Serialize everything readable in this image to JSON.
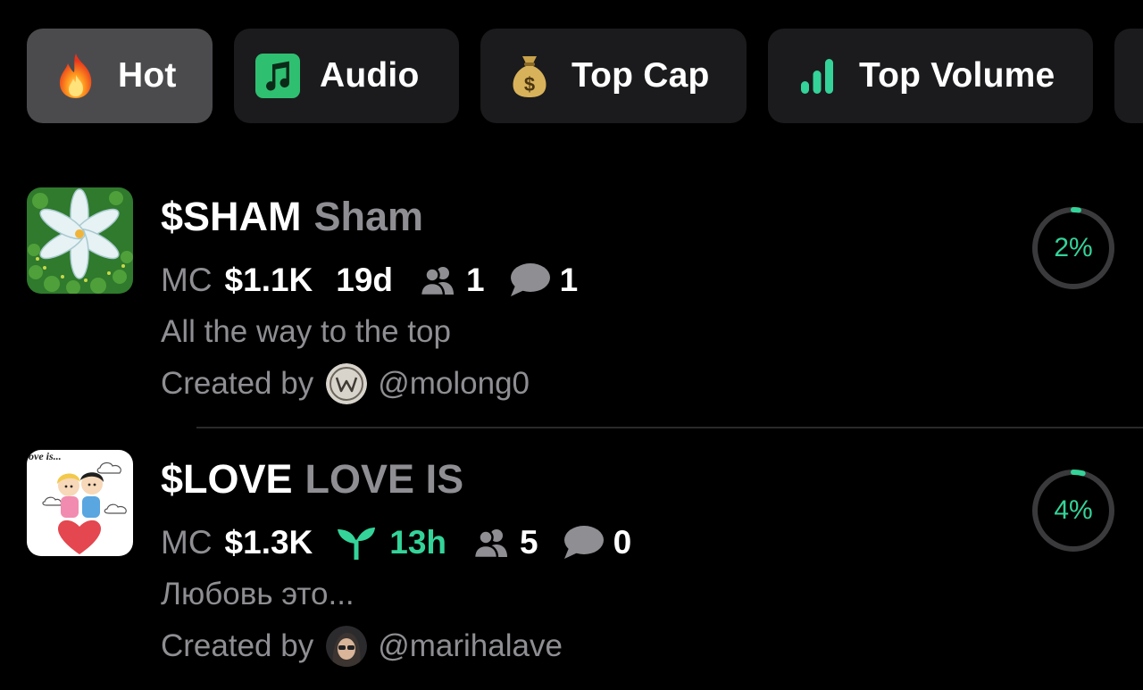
{
  "tabs": [
    {
      "label": "Hot",
      "icon": "fire-icon",
      "active": true
    },
    {
      "label": "Audio",
      "icon": "music-note-icon",
      "active": false
    },
    {
      "label": "Top Cap",
      "icon": "money-bag-icon",
      "active": false
    },
    {
      "label": "Top Volume",
      "icon": "bar-chart-icon",
      "active": false
    }
  ],
  "tokens": [
    {
      "ticker": "$SHAM",
      "name": "Sham",
      "mc_label": "MC",
      "mc_value": "$1.1K",
      "age": "19d",
      "holders": "1",
      "comments": "1",
      "description": "All the way to the top",
      "created_by_label": "Created by",
      "creator": "@molong0",
      "progress_text": "2%",
      "progress": 0.02
    },
    {
      "ticker": "$LOVE",
      "name": "LOVE IS",
      "mc_label": "MC",
      "mc_value": "$1.3K",
      "age": "13h",
      "holders": "5",
      "comments": "0",
      "description": "Любовь это...",
      "created_by_label": "Created by",
      "creator": "@marihalave",
      "progress_text": "4%",
      "progress": 0.04
    }
  ],
  "colors": {
    "background": "#000000",
    "tab_bg": "#1b1b1d",
    "tab_active_bg": "#4b4b4e",
    "muted_text": "#8e8e93",
    "accent_green": "#34d399",
    "ring_track": "#3a3a3c"
  }
}
